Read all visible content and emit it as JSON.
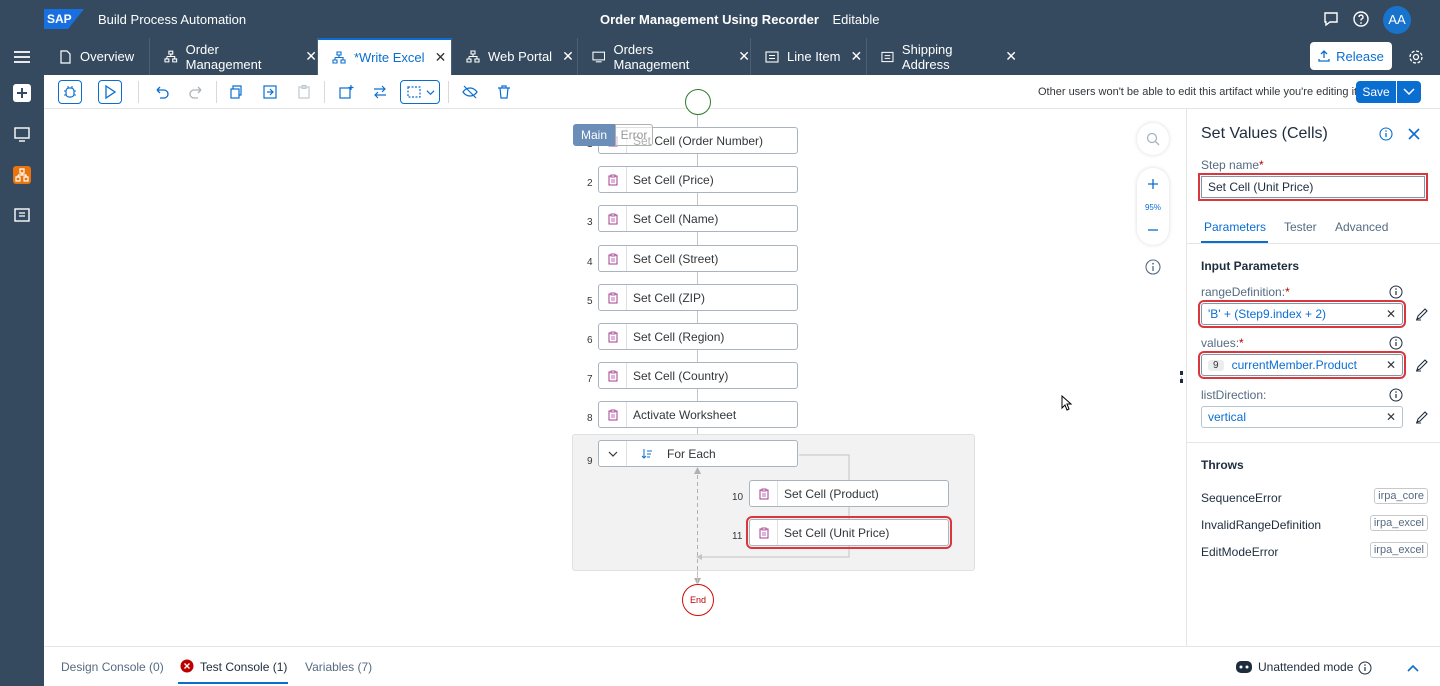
{
  "shell": {
    "logo_text": "SAP",
    "product": "Build Process Automation",
    "project_title": "Order Management Using Recorder",
    "mode": "Editable",
    "avatar_initials": "AA"
  },
  "tabs": [
    {
      "label": "Overview",
      "icon": "document-icon",
      "closable": false
    },
    {
      "label": "Order Management",
      "icon": "process-icon",
      "closable": true
    },
    {
      "label": "*Write Excel",
      "icon": "automation-icon",
      "closable": true,
      "active": true
    },
    {
      "label": "Web Portal",
      "icon": "automation-icon",
      "closable": true
    },
    {
      "label": "Orders Management",
      "icon": "screen-icon",
      "closable": true
    },
    {
      "label": "Line Item",
      "icon": "form-icon",
      "closable": true
    },
    {
      "label": "Shipping Address",
      "icon": "form-icon",
      "closable": true
    }
  ],
  "tab_close_glyph": "✕",
  "release_label": "Release",
  "toolbar": {
    "notice": "Other users won't be able to edit this artifact while you're editing it.",
    "save_label": "Save"
  },
  "canvas": {
    "main_tab": "Main",
    "error_tab": "Error",
    "steps": [
      {
        "num": "1",
        "label": "Set Cell (Order Number)"
      },
      {
        "num": "2",
        "label": "Set Cell (Price)"
      },
      {
        "num": "3",
        "label": "Set Cell (Name)"
      },
      {
        "num": "4",
        "label": "Set Cell (Street)"
      },
      {
        "num": "5",
        "label": "Set Cell (ZIP)"
      },
      {
        "num": "6",
        "label": "Set Cell (Region)"
      },
      {
        "num": "7",
        "label": "Set Cell (Country)"
      },
      {
        "num": "8",
        "label": "Activate Worksheet"
      }
    ],
    "loop": {
      "num": "9",
      "label": "For Each"
    },
    "loop_steps": [
      {
        "num": "10",
        "label": "Set Cell (Product)"
      },
      {
        "num": "11",
        "label": "Set Cell (Unit Price)"
      }
    ],
    "end_label": "End",
    "zoom_level": "95%"
  },
  "panel": {
    "title": "Set Values (Cells)",
    "step_name_label": "Step name",
    "step_name_value": "Set Cell (Unit Price)",
    "required_mark": "*",
    "tabs": [
      "Parameters",
      "Tester",
      "Advanced"
    ],
    "input_params_heading": "Input Parameters",
    "params": [
      {
        "label": "rangeDefinition:",
        "required": true,
        "value": "'B' + (Step9.index + 2)"
      },
      {
        "label": "values:",
        "required": true,
        "badge": "9",
        "value": "currentMember.Product"
      },
      {
        "label": "listDirection:",
        "required": false,
        "value": "vertical"
      }
    ],
    "throws_heading": "Throws",
    "throws": [
      {
        "name": "SequenceError",
        "tag": "irpa_core"
      },
      {
        "name": "InvalidRangeDefinition",
        "tag": "irpa_excel"
      },
      {
        "name": "EditModeError",
        "tag": "irpa_excel"
      }
    ]
  },
  "bottom": {
    "tabs": [
      "Design Console (0)",
      "Test Console (1)",
      "Variables (7)"
    ],
    "unattended": "Unattended mode"
  }
}
